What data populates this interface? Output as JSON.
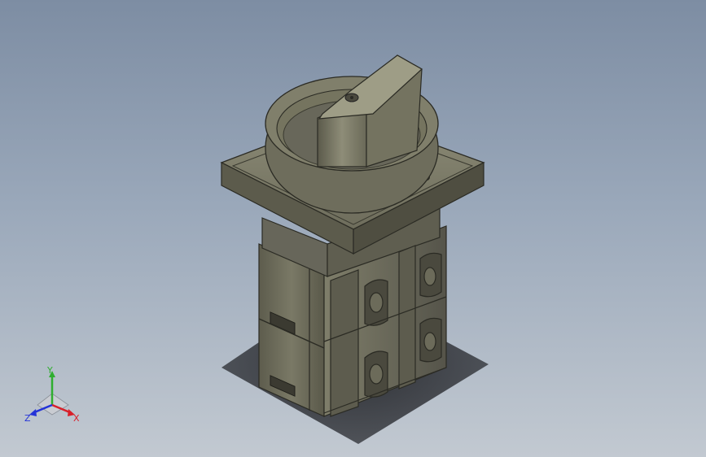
{
  "scene": {
    "background_top": "#7d8da3",
    "background_bottom": "#c2c9d1",
    "model_color": "#6f6e5d",
    "model_shadow": "#4f4e41",
    "model_highlight": "#9a9983"
  },
  "triad": {
    "x_label": "X",
    "y_label": "Y",
    "z_label": "Z",
    "x_color": "#d8202a",
    "y_color": "#2fae2f",
    "z_color": "#2433d8"
  }
}
